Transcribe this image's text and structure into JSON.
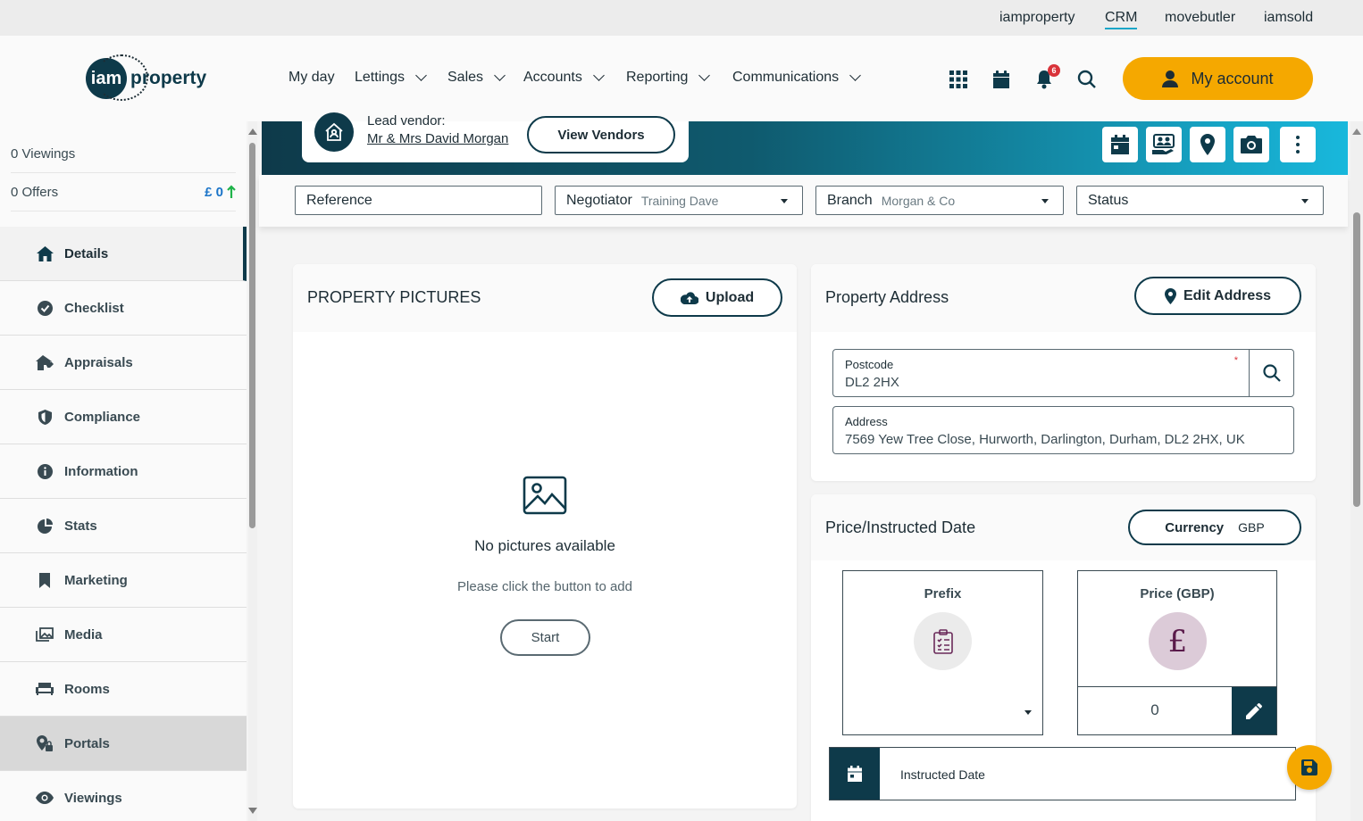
{
  "top_links": [
    {
      "label": "iamproperty",
      "active": false
    },
    {
      "label": "CRM",
      "active": true
    },
    {
      "label": "movebutler",
      "active": false
    },
    {
      "label": "iamsold",
      "active": false
    }
  ],
  "logo": {
    "mark": "iam",
    "word": "property"
  },
  "nav": [
    {
      "label": "My day",
      "dropdown": false
    },
    {
      "label": "Lettings",
      "dropdown": true
    },
    {
      "label": "Sales",
      "dropdown": true
    },
    {
      "label": "Accounts",
      "dropdown": true
    },
    {
      "label": "Reporting",
      "dropdown": true
    },
    {
      "label": "Communications",
      "dropdown": true
    }
  ],
  "header_icons": {
    "apps": "grid-icon",
    "calendar": "calendar-icon",
    "notifications": "bell-icon",
    "notification_count": "6",
    "search": "search-icon"
  },
  "my_account": {
    "label": "My account"
  },
  "sidebar": {
    "stats": [
      {
        "label": "0 Viewings",
        "value": ""
      },
      {
        "label": "0 Offers",
        "value": "£ 0"
      }
    ],
    "items": [
      {
        "label": "Details",
        "icon": "home-icon",
        "state": "active"
      },
      {
        "label": "Checklist",
        "icon": "check-circle-icon",
        "state": ""
      },
      {
        "label": "Appraisals",
        "icon": "house-tag-icon",
        "state": ""
      },
      {
        "label": "Compliance",
        "icon": "shield-icon",
        "state": ""
      },
      {
        "label": "Information",
        "icon": "info-icon",
        "state": ""
      },
      {
        "label": "Stats",
        "icon": "pie-chart-icon",
        "state": ""
      },
      {
        "label": "Marketing",
        "icon": "bookmark-icon",
        "state": ""
      },
      {
        "label": "Media",
        "icon": "images-icon",
        "state": ""
      },
      {
        "label": "Rooms",
        "icon": "sofa-icon",
        "state": ""
      },
      {
        "label": "Portals",
        "icon": "map-lock-icon",
        "state": "hover"
      },
      {
        "label": "Viewings",
        "icon": "eye-icon",
        "state": ""
      }
    ]
  },
  "banner": {
    "vendor_title": "Lead vendor:",
    "vendor_name": "Mr & Mrs David Morgan",
    "view_vendors": "View Vendors",
    "actions": [
      "calendar-icon",
      "people-icon",
      "map-pin-icon",
      "camera-icon",
      "more-vertical-icon"
    ]
  },
  "filters": {
    "reference": {
      "label": "Reference",
      "value": ""
    },
    "negotiator": {
      "label": "Negotiator",
      "value": "Training Dave"
    },
    "branch": {
      "label": "Branch",
      "value": "Morgan & Co"
    },
    "status": {
      "label": "Status",
      "value": ""
    }
  },
  "pictures": {
    "title": "PROPERTY PICTURES",
    "upload": "Upload",
    "empty_title": "No pictures available",
    "empty_sub": "Please click the button to add",
    "start": "Start"
  },
  "address": {
    "title": "Property Address",
    "edit": "Edit Address",
    "postcode_label": "Postcode",
    "postcode_value": "DL2 2HX",
    "required_mark": "*",
    "address_label": "Address",
    "address_value": "7569 Yew Tree Close, Hurworth, Darlington, Durham, DL2 2HX, UK"
  },
  "price": {
    "title": "Price/Instructed Date",
    "currency_label": "Currency",
    "currency_value": "GBP",
    "prefix_label": "Prefix",
    "price_label": "Price (GBP)",
    "price_symbol": "£",
    "price_value": "0",
    "instructed_label": "Instructed Date"
  },
  "colors": {
    "accent": "#f5a800",
    "brand": "#0e3a4a",
    "link": "#1a74c8",
    "badge": "#d9333a"
  }
}
